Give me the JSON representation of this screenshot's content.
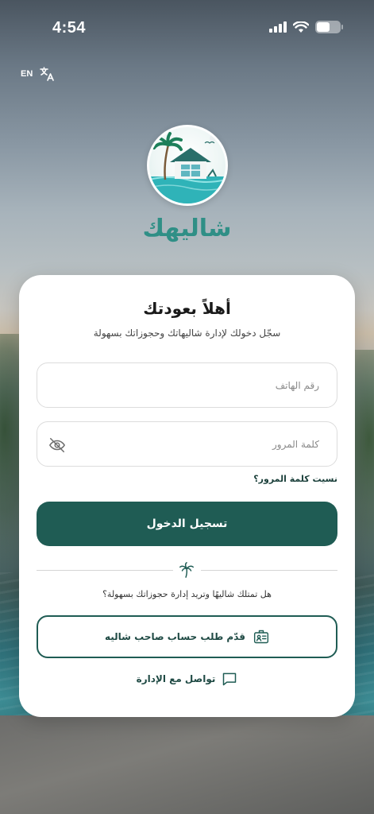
{
  "status_bar": {
    "time": "4:54"
  },
  "language": {
    "code": "EN",
    "icon": "translate-icon"
  },
  "brand": {
    "logo_icon": "chalet-logo-icon",
    "name": "شاليهك"
  },
  "login_card": {
    "title": "أهلاً بعودتك",
    "subtitle": "سجّل دخولك لإدارة شاليهاتك وحجوزاتك بسهولة",
    "phone_field": {
      "placeholder": "رقم الهاتف",
      "value": ""
    },
    "password_field": {
      "placeholder": "كلمة المرور",
      "value": "",
      "toggle_icon": "eye-off-icon"
    },
    "forgot_password": "نسيت كلمة المرور؟",
    "login_button": "تسجيل الدخول",
    "divider_icon": "palm-tree-icon",
    "owner_question": "هل تمتلك شاليهًا وتريد إدارة حجوزاتك بسهولة؟",
    "owner_button": {
      "label": "قدّم طلب حساب صاحب شاليه",
      "icon": "id-card-icon"
    },
    "contact_link": {
      "label": "تواصل مع الإدارة",
      "icon": "chat-bubble-icon"
    }
  },
  "colors": {
    "primary": "#1f5c54",
    "brand_text": "#2f8f86",
    "card_bg": "#ffffff"
  }
}
